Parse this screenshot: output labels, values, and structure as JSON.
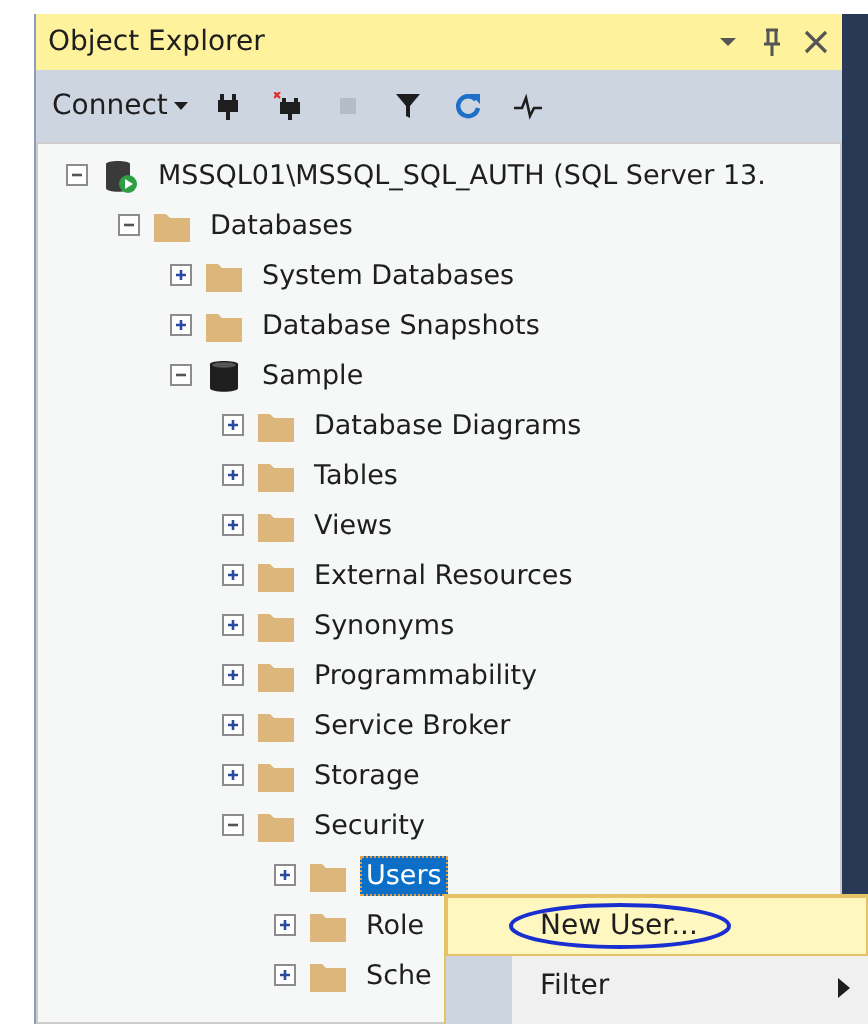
{
  "panel": {
    "title": "Object Explorer"
  },
  "toolbar": {
    "connect_label": "Connect",
    "buttons": [
      {
        "kind": "connect",
        "disabled": false
      },
      {
        "kind": "disconnect",
        "disabled": false
      },
      {
        "kind": "stop",
        "disabled": true
      },
      {
        "kind": "filter",
        "disabled": false
      },
      {
        "kind": "refresh",
        "disabled": false
      },
      {
        "kind": "activity",
        "disabled": false
      }
    ]
  },
  "tree": [
    {
      "label": "MSSQL01\\MSSQL_SQL_AUTH (SQL Server 13.",
      "kind": "server",
      "expanded": true,
      "selected": false,
      "children": [
        {
          "label": "Databases",
          "kind": "folder",
          "expanded": true,
          "selected": false,
          "children": [
            {
              "label": "System Databases",
              "kind": "folder",
              "expanded": false,
              "selected": false
            },
            {
              "label": "Database Snapshots",
              "kind": "folder",
              "expanded": false,
              "selected": false
            },
            {
              "label": "Sample",
              "kind": "database",
              "expanded": true,
              "selected": false,
              "children": [
                {
                  "label": "Database Diagrams",
                  "kind": "folder",
                  "expanded": false,
                  "selected": false
                },
                {
                  "label": "Tables",
                  "kind": "folder",
                  "expanded": false,
                  "selected": false
                },
                {
                  "label": "Views",
                  "kind": "folder",
                  "expanded": false,
                  "selected": false
                },
                {
                  "label": "External Resources",
                  "kind": "folder",
                  "expanded": false,
                  "selected": false
                },
                {
                  "label": "Synonyms",
                  "kind": "folder",
                  "expanded": false,
                  "selected": false
                },
                {
                  "label": "Programmability",
                  "kind": "folder",
                  "expanded": false,
                  "selected": false
                },
                {
                  "label": "Service Broker",
                  "kind": "folder",
                  "expanded": false,
                  "selected": false
                },
                {
                  "label": "Storage",
                  "kind": "folder",
                  "expanded": false,
                  "selected": false
                },
                {
                  "label": "Security",
                  "kind": "folder",
                  "expanded": true,
                  "selected": false,
                  "children": [
                    {
                      "label": "Users",
                      "kind": "folder",
                      "expanded": false,
                      "selected": true
                    },
                    {
                      "label": "Role",
                      "kind": "folder",
                      "expanded": false,
                      "selected": false
                    },
                    {
                      "label": "Sche",
                      "kind": "folder",
                      "expanded": false,
                      "selected": false
                    }
                  ]
                }
              ]
            }
          ]
        }
      ]
    }
  ],
  "context_menu": [
    {
      "label": "New User...",
      "selected": true,
      "circled": true,
      "submenu": false
    },
    {
      "label": "Filter",
      "selected": false,
      "circled": false,
      "submenu": true
    }
  ]
}
